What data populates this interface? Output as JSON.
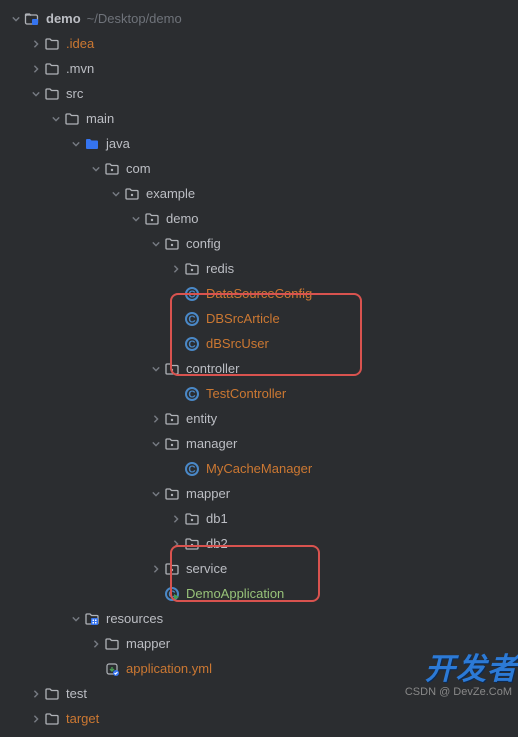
{
  "root": {
    "name": "demo",
    "path": "~/Desktop/demo"
  },
  "watermark_main": "开发者",
  "watermark_sub": "CSDN @ DevZe.CoM",
  "tree": [
    {
      "depth": 0,
      "expand": "open",
      "icon": "project",
      "label": "demo",
      "bold": true,
      "hint": "~/Desktop/demo"
    },
    {
      "depth": 1,
      "expand": "closed",
      "icon": "folder",
      "label": ".idea",
      "color": "orange"
    },
    {
      "depth": 1,
      "expand": "closed",
      "icon": "folder",
      "label": ".mvn"
    },
    {
      "depth": 1,
      "expand": "open",
      "icon": "folder",
      "label": "src"
    },
    {
      "depth": 2,
      "expand": "open",
      "icon": "folder",
      "label": "main"
    },
    {
      "depth": 3,
      "expand": "open",
      "icon": "folder-blue",
      "label": "java"
    },
    {
      "depth": 4,
      "expand": "open",
      "icon": "package",
      "label": "com"
    },
    {
      "depth": 5,
      "expand": "open",
      "icon": "package",
      "label": "example"
    },
    {
      "depth": 6,
      "expand": "open",
      "icon": "package",
      "label": "demo"
    },
    {
      "depth": 7,
      "expand": "open",
      "icon": "package",
      "label": "config"
    },
    {
      "depth": 8,
      "expand": "closed",
      "icon": "package",
      "label": "redis"
    },
    {
      "depth": 8,
      "expand": "none",
      "icon": "class",
      "label": "DataSourceConfig",
      "color": "orange"
    },
    {
      "depth": 8,
      "expand": "none",
      "icon": "class",
      "label": "DBSrcArticle",
      "color": "orange"
    },
    {
      "depth": 8,
      "expand": "none",
      "icon": "class",
      "label": "dBSrcUser",
      "color": "orange"
    },
    {
      "depth": 7,
      "expand": "open",
      "icon": "package",
      "label": "controller"
    },
    {
      "depth": 8,
      "expand": "none",
      "icon": "class",
      "label": "TestController",
      "color": "orange"
    },
    {
      "depth": 7,
      "expand": "closed",
      "icon": "package",
      "label": "entity"
    },
    {
      "depth": 7,
      "expand": "open",
      "icon": "package",
      "label": "manager"
    },
    {
      "depth": 8,
      "expand": "none",
      "icon": "class",
      "label": "MyCacheManager",
      "color": "orange"
    },
    {
      "depth": 7,
      "expand": "open",
      "icon": "package",
      "label": "mapper"
    },
    {
      "depth": 8,
      "expand": "closed",
      "icon": "package",
      "label": "db1"
    },
    {
      "depth": 8,
      "expand": "closed",
      "icon": "package",
      "label": "db2"
    },
    {
      "depth": 7,
      "expand": "closed",
      "icon": "package",
      "label": "service"
    },
    {
      "depth": 7,
      "expand": "none",
      "icon": "runclass",
      "label": "DemoApplication",
      "color": "green"
    },
    {
      "depth": 3,
      "expand": "open",
      "icon": "resources",
      "label": "resources"
    },
    {
      "depth": 4,
      "expand": "closed",
      "icon": "folder",
      "label": "mapper"
    },
    {
      "depth": 4,
      "expand": "none",
      "icon": "yml",
      "label": "application.yml",
      "color": "orange"
    },
    {
      "depth": 1,
      "expand": "closed",
      "icon": "folder",
      "label": "test"
    },
    {
      "depth": 1,
      "expand": "closed",
      "icon": "folder",
      "label": "target",
      "color": "orange"
    }
  ]
}
